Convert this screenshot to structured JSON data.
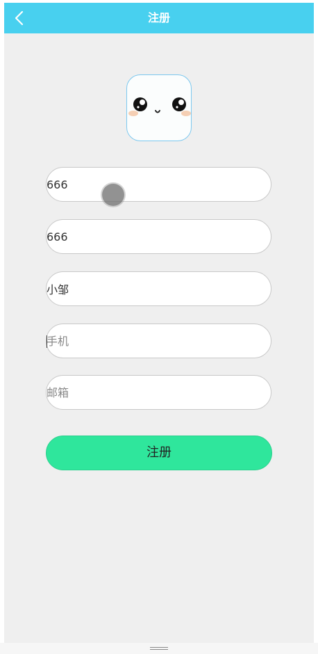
{
  "header": {
    "title": "注册",
    "back_icon": "chevron-left-icon",
    "background": "#48d0ef"
  },
  "avatar": {
    "icon": "cute-face-icon"
  },
  "form": {
    "fields": [
      {
        "value": "666",
        "placeholder": ""
      },
      {
        "value": "666",
        "placeholder": ""
      },
      {
        "value": "小邹",
        "placeholder": ""
      },
      {
        "value": "",
        "placeholder": "手机"
      },
      {
        "value": "",
        "placeholder": "邮箱"
      }
    ],
    "submit_label": "注册",
    "submit_color": "#2fe69c"
  }
}
